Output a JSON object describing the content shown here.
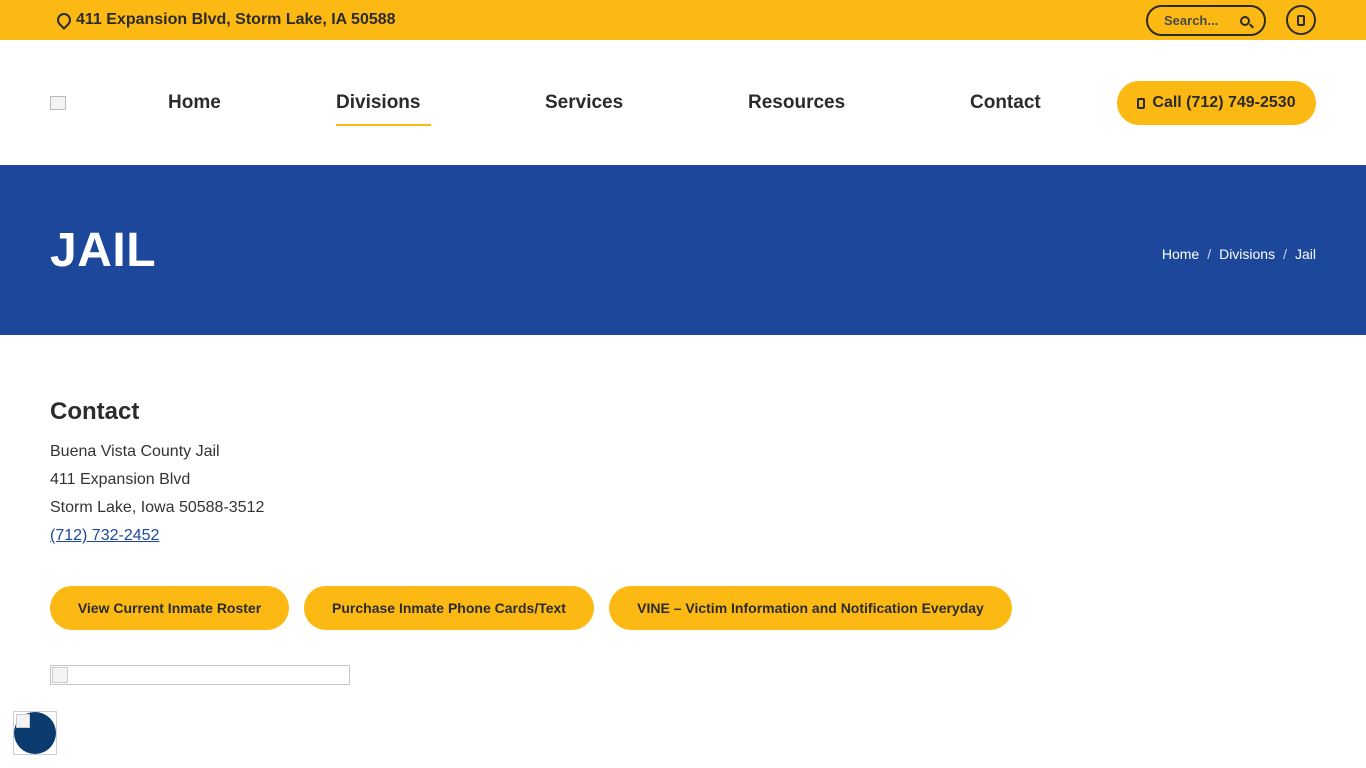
{
  "topbar": {
    "address": "411 Expansion Blvd, Storm Lake, IA 50588",
    "search_placeholder": "Search..."
  },
  "nav": {
    "items": [
      {
        "label": "Home"
      },
      {
        "label": "Divisions",
        "active": true
      },
      {
        "label": "Services"
      },
      {
        "label": "Resources"
      },
      {
        "label": "Contact"
      }
    ],
    "call_button": "Call (712) 749-2530"
  },
  "hero": {
    "title": "JAIL",
    "breadcrumb": [
      "Home",
      "Divisions",
      "Jail"
    ]
  },
  "contact": {
    "heading": "Contact",
    "lines": [
      "Buena Vista County Jail",
      "411 Expansion Blvd",
      "Storm Lake, Iowa 50588-3512"
    ],
    "phone": "(712) 732-2452"
  },
  "buttons": [
    "View Current Inmate Roster",
    "Purchase Inmate Phone Cards/Text",
    "VINE – Victim Information and Notification Everyday"
  ],
  "colors": {
    "accent": "#fcb914",
    "hero": "#1c479b",
    "text": "#2b2b2b"
  }
}
